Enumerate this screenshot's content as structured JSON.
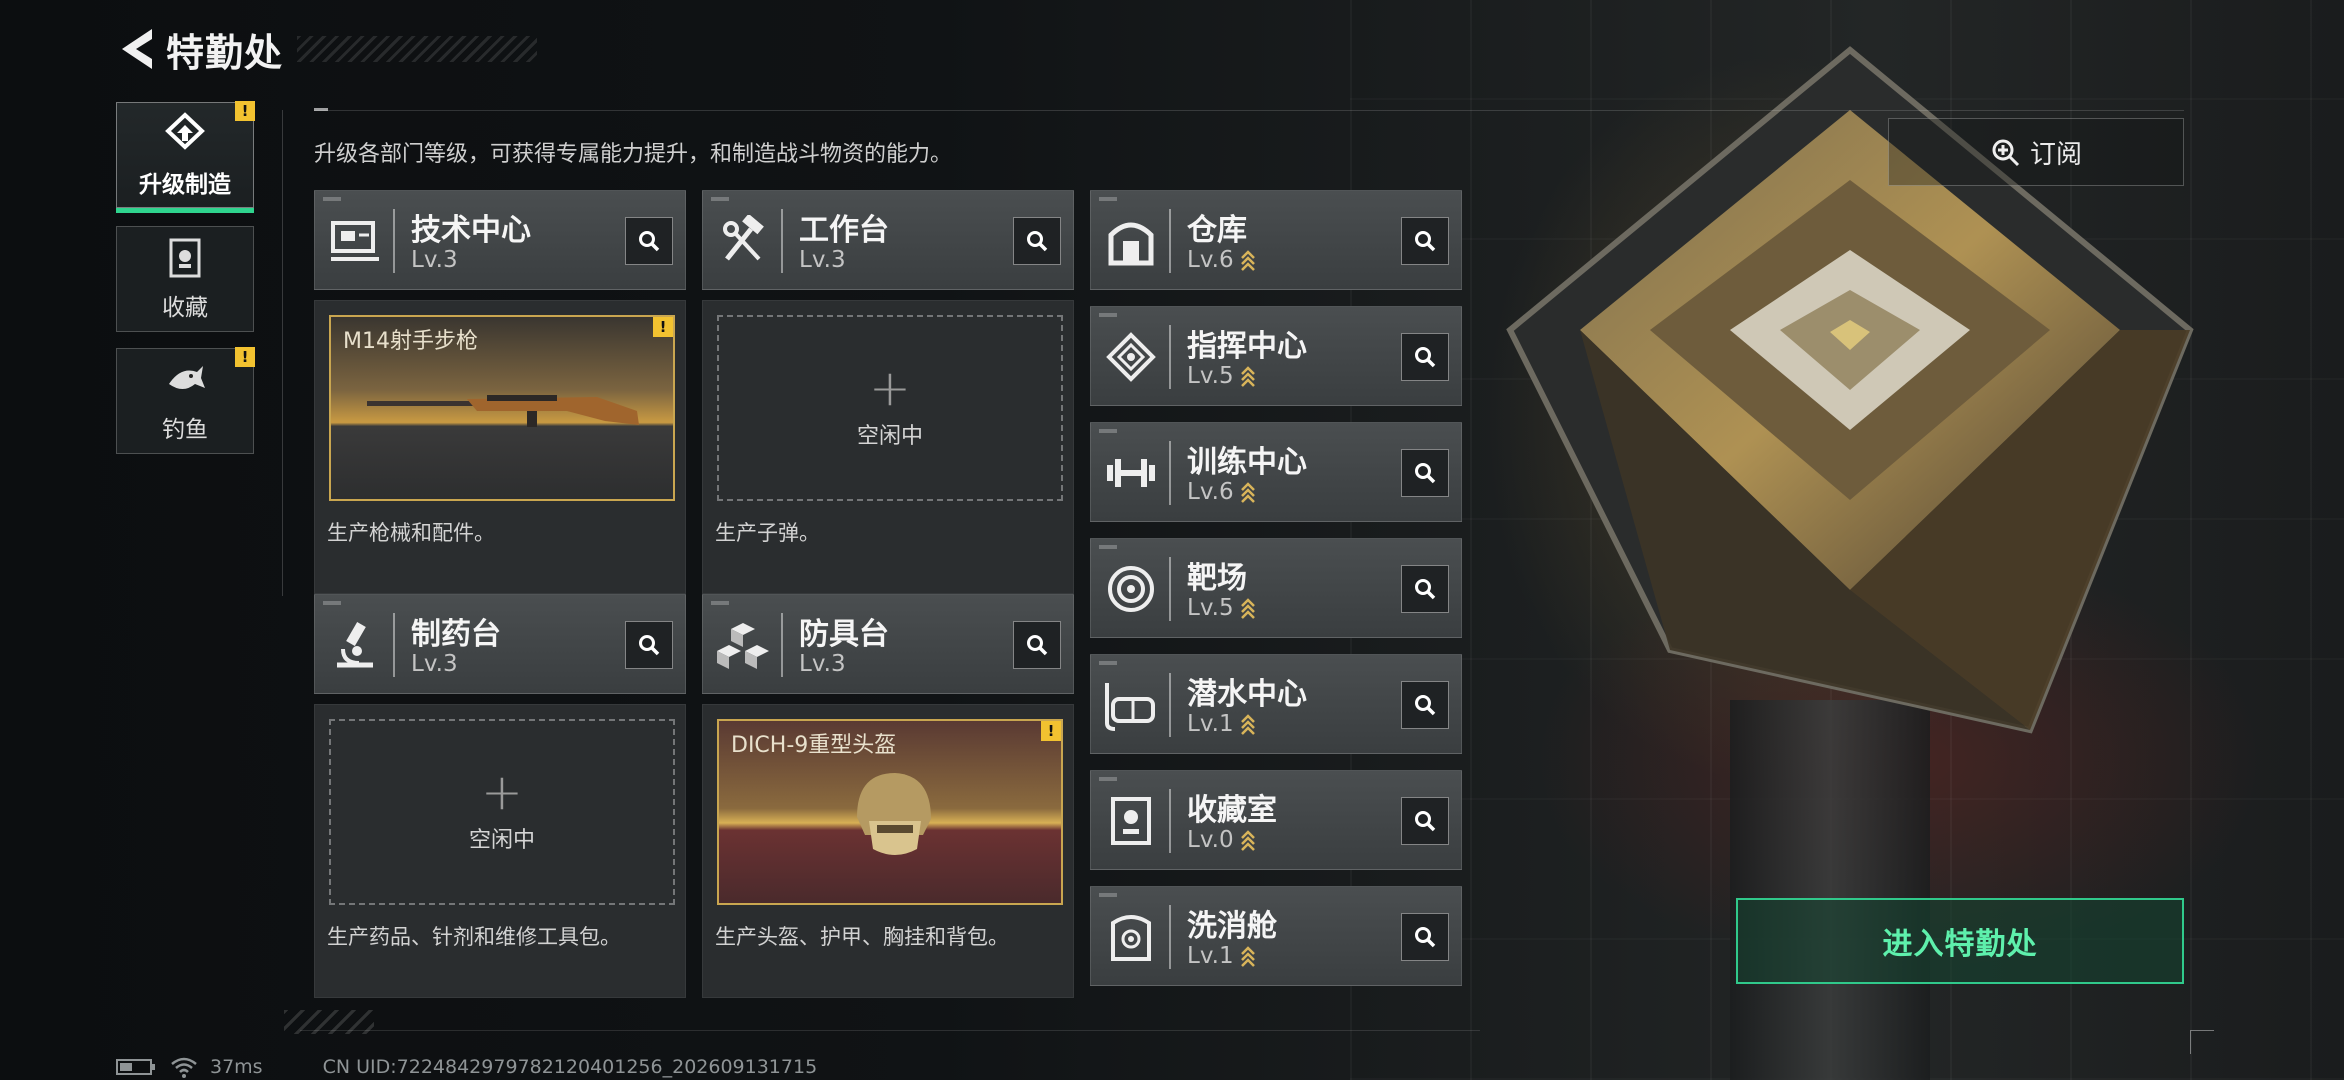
{
  "header": {
    "title": "特勤处"
  },
  "sidebar": {
    "items": [
      {
        "label": "升级制造",
        "icon": "upgrade-icon",
        "active": true,
        "badge": "!"
      },
      {
        "label": "收藏",
        "icon": "collection-icon",
        "active": false,
        "badge": ""
      },
      {
        "label": "钓鱼",
        "icon": "fish-icon",
        "active": false,
        "badge": "!"
      }
    ]
  },
  "description": "升级各部门等级，可获得专属能力提升，和制造战斗物资的能力。",
  "departments": {
    "tech_center": {
      "name": "技术中心",
      "level": "Lv.3",
      "icon": "circuit-board-icon",
      "slot": {
        "item": "M14射手步枪",
        "badge": "!"
      },
      "desc": "生产枪械和配件。"
    },
    "workbench": {
      "name": "工作台",
      "level": "Lv.3",
      "icon": "hammer-wrench-icon",
      "slot": {
        "plus": "+",
        "status": "空闲中"
      },
      "desc": "生产子弹。"
    },
    "pharmacy": {
      "name": "制药台",
      "level": "Lv.3",
      "icon": "microscope-icon",
      "slot": {
        "plus": "+",
        "status": "空闲中"
      },
      "desc": "生产药品、针剂和维修工具包。"
    },
    "armory": {
      "name": "防具台",
      "level": "Lv.3",
      "icon": "armor-blocks-icon",
      "slot": {
        "item": "DICH-9重型头盔",
        "badge": "!"
      },
      "desc": "生产头盔、护甲、胸挂和背包。"
    },
    "rows": [
      {
        "name": "仓库",
        "level": "Lv.6",
        "icon": "warehouse-icon"
      },
      {
        "name": "指挥中心",
        "level": "Lv.5",
        "icon": "command-icon"
      },
      {
        "name": "训练中心",
        "level": "Lv.6",
        "icon": "dumbbell-icon"
      },
      {
        "name": "靶场",
        "level": "Lv.5",
        "icon": "target-icon"
      },
      {
        "name": "潜水中心",
        "level": "Lv.1",
        "icon": "dive-mask-icon"
      },
      {
        "name": "收藏室",
        "level": "Lv.0",
        "icon": "trophy-case-icon"
      },
      {
        "name": "洗消舱",
        "level": "Lv.1",
        "icon": "decon-icon"
      }
    ]
  },
  "subscribe": {
    "label": "订阅",
    "icon": "subscribe-icon"
  },
  "enter_button": {
    "label": "进入特勤处"
  },
  "status_bar": {
    "ping": "37ms",
    "uid": "CN UID:7224842979782120401256_202609131715",
    "battery_icon": "battery-icon",
    "wifi_icon": "wifi-icon"
  },
  "colors": {
    "accent_green": "#2fd48e",
    "badge_yellow": "#f2c230",
    "gold_frame": "#c9a650"
  }
}
